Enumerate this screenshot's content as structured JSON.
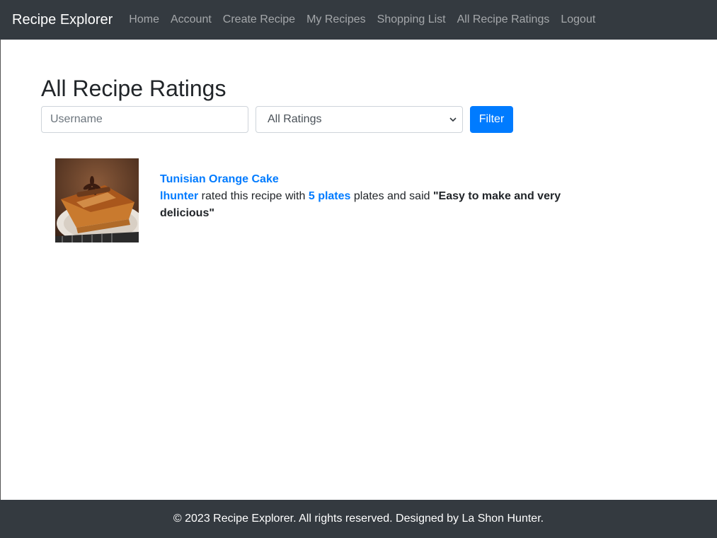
{
  "navbar": {
    "brand": "Recipe Explorer",
    "links": [
      "Home",
      "Account",
      "Create Recipe",
      "My Recipes",
      "Shopping List",
      "All Recipe Ratings",
      "Logout"
    ]
  },
  "page": {
    "title": "All Recipe Ratings"
  },
  "filters": {
    "username_placeholder": "Username",
    "username_value": "",
    "rating_selected": "All Ratings",
    "filter_button": "Filter"
  },
  "ratings": [
    {
      "recipe": "Tunisian Orange Cake",
      "user": "lhunter",
      "middle_text": " rated this recipe with ",
      "plates": "5 plates",
      "after_text": " plates and said ",
      "comment": "\"Easy to make and very delicious\""
    }
  ],
  "footer": {
    "text": "© 2023 Recipe Explorer. All rights reserved. Designed by La Shon Hunter."
  },
  "colors": {
    "navbar": "#343a40",
    "link": "#007bff",
    "button": "#007bff"
  }
}
